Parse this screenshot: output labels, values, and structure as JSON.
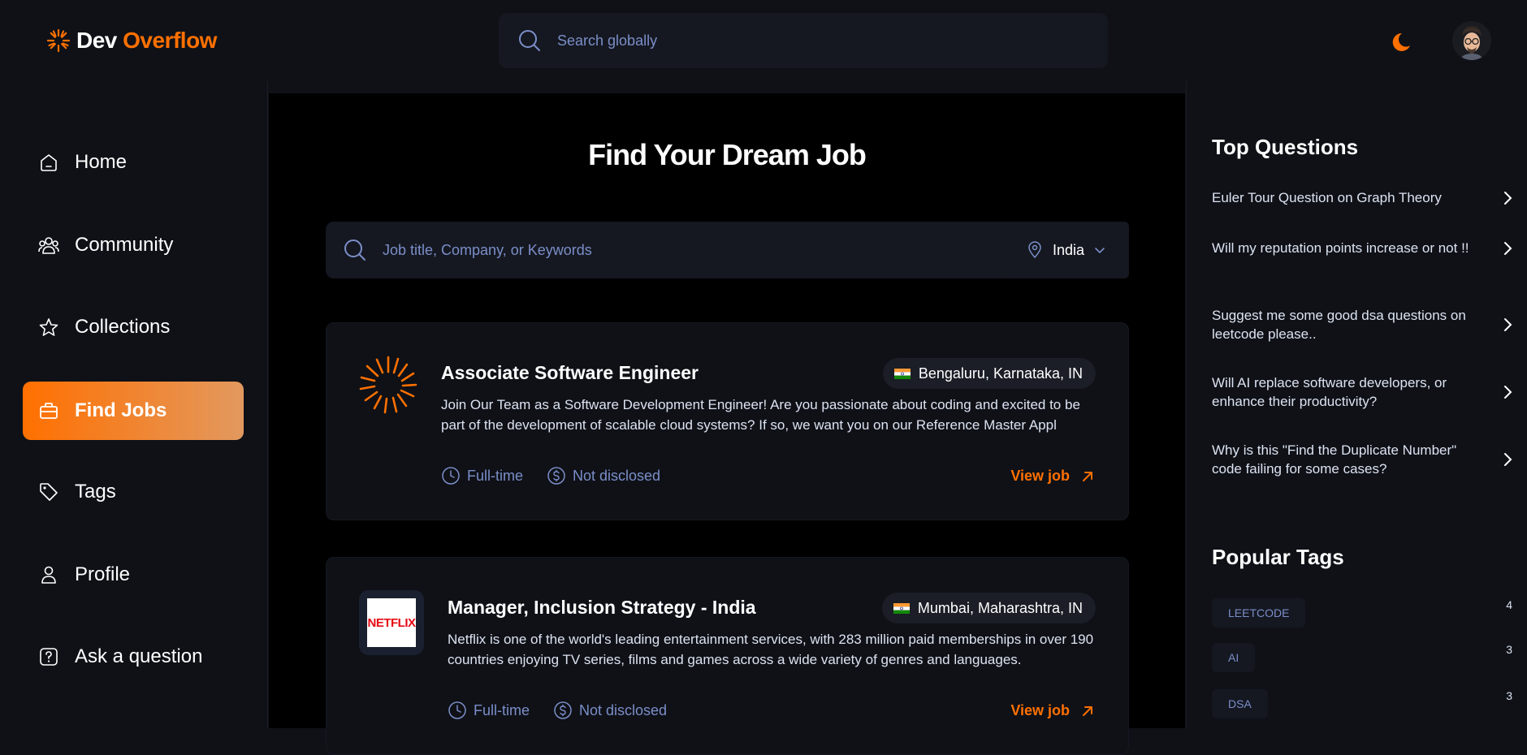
{
  "app": {
    "logo_part1": "Dev",
    "logo_part2": "Overflow",
    "search_placeholder": "Search globally"
  },
  "colors": {
    "accent": "#ff7000",
    "background": "#0f1117",
    "card": "#151821",
    "muted": "#7b8ec8"
  },
  "sidebar": {
    "items": [
      {
        "label": "Home",
        "icon": "home-icon"
      },
      {
        "label": "Community",
        "icon": "users-icon"
      },
      {
        "label": "Collections",
        "icon": "star-icon"
      },
      {
        "label": "Find Jobs",
        "icon": "briefcase-icon",
        "active": true
      },
      {
        "label": "Tags",
        "icon": "tag-icon"
      },
      {
        "label": "Profile",
        "icon": "user-icon"
      },
      {
        "label": "Ask a question",
        "icon": "question-icon"
      }
    ]
  },
  "main": {
    "title": "Find Your Dream Job",
    "search_placeholder": "Job title, Company, or Keywords",
    "location": "India",
    "jobs": [
      {
        "title": "Associate Software Engineer",
        "location": "Bengaluru, Karnataka, IN",
        "description": "Join Our Team as a Software Development Engineer!  Are you passionate about coding and excited to be part of the development of scalable cloud systems? If so, we want you on our Reference Master Appl",
        "employment_type": "Full-time",
        "salary": "Not disclosed",
        "action": "View job"
      },
      {
        "title": "Manager, Inclusion Strategy - India",
        "location": "Mumbai, Maharashtra, IN",
        "company_logo_text": "NETFLIX",
        "description": "Netflix is one of the world's leading entertainment services, with 283 million paid memberships in over 190 countries enjoying TV series, films and games across a wide variety of genres and languages.",
        "employment_type": "Full-time",
        "salary": "Not disclosed",
        "action": "View job"
      }
    ]
  },
  "right_sidebar": {
    "top_questions_title": "Top Questions",
    "questions": [
      "Euler Tour Question on Graph Theory",
      "Will my reputation points increase or not !!",
      "Suggest me some good dsa questions on leetcode please..",
      "Will AI replace software developers, or enhance their productivity?",
      "Why is this \"Find the Duplicate Number\" code failing for some cases?"
    ],
    "popular_tags_title": "Popular Tags",
    "tags": [
      {
        "name": "LEETCODE",
        "count": "4"
      },
      {
        "name": "AI",
        "count": "3"
      },
      {
        "name": "DSA",
        "count": "3"
      }
    ]
  }
}
